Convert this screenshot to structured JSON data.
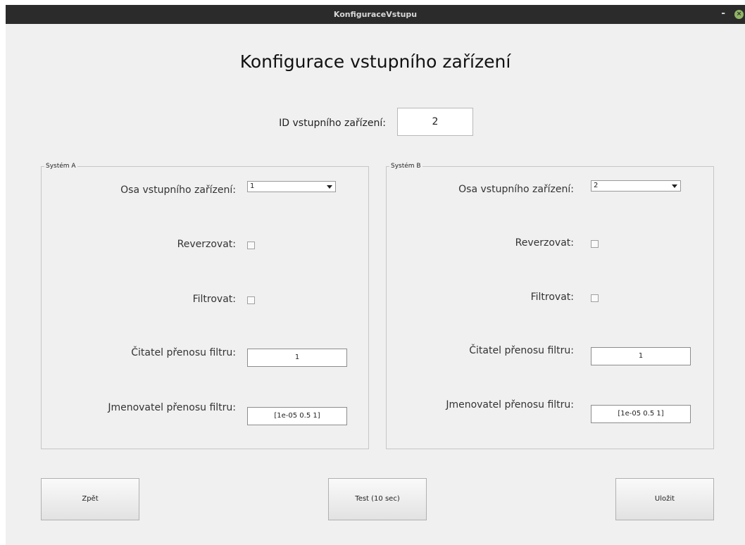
{
  "window": {
    "title": "KonfiguraceVstupu",
    "minimize_label": "-"
  },
  "heading": "Konfigurace vstupního zařízení",
  "device_id": {
    "label": "ID vstupního zařízení:",
    "value": "2"
  },
  "system_a": {
    "legend": "Systém A",
    "axis_label": "Osa vstupního zařízení:",
    "axis_value": "1",
    "reverse_label": "Reverzovat:",
    "reverse_checked": false,
    "filter_label": "Filtrovat:",
    "filter_checked": false,
    "numerator_label": "Čitatel přenosu filtru:",
    "numerator_value": "1",
    "denominator_label": "Jmenovatel přenosu filtru:",
    "denominator_value": "[1e-05 0.5 1]"
  },
  "system_b": {
    "legend": "Systém B",
    "axis_label": "Osa vstupního zařízení:",
    "axis_value": "2",
    "reverse_label": "Reverzovat:",
    "reverse_checked": false,
    "filter_label": "Filtrovat:",
    "filter_checked": false,
    "numerator_label": "Čitatel přenosu filtru:",
    "numerator_value": "1",
    "denominator_label": "Jmenovatel přenosu filtru:",
    "denominator_value": "[1e-05 0.5 1]"
  },
  "buttons": {
    "back": "Zpět",
    "test": "Test (10 sec)",
    "save": "Uložit"
  },
  "icons": {
    "minimize": "minimize-icon",
    "close": "close-icon",
    "dropdown": "chevron-down-icon"
  },
  "colors": {
    "titlebar": "#2b2b2b",
    "background": "#f0f0f0",
    "close_button": "#8fb564"
  }
}
